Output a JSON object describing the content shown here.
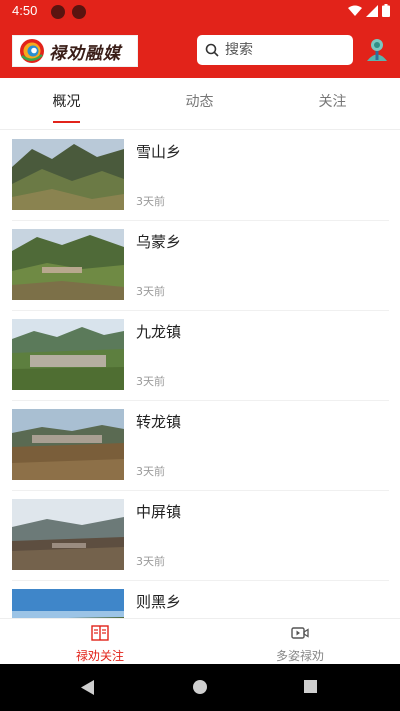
{
  "status_bar": {
    "time": "4:50"
  },
  "header": {
    "logo_text": "禄劝融媒",
    "search_placeholder": "搜索",
    "brand_color": "#e2231a"
  },
  "tabs": [
    {
      "label": "概况",
      "active": true
    },
    {
      "label": "动态",
      "active": false
    },
    {
      "label": "关注",
      "active": false
    }
  ],
  "list": [
    {
      "title": "雪山乡",
      "time": "3天前"
    },
    {
      "title": "乌蒙乡",
      "time": "3天前"
    },
    {
      "title": "九龙镇",
      "time": "3天前"
    },
    {
      "title": "转龙镇",
      "time": "3天前"
    },
    {
      "title": "中屏镇",
      "time": "3天前"
    },
    {
      "title": "则黑乡",
      "time": ""
    }
  ],
  "bottom_nav": [
    {
      "label": "禄劝关注",
      "icon": "book-icon",
      "active": true
    },
    {
      "label": "多姿禄劝",
      "icon": "video-icon",
      "active": false
    }
  ],
  "icons": {
    "status": [
      "wifi-icon",
      "signal-icon",
      "battery-icon"
    ],
    "system_nav": [
      "back-icon",
      "home-icon",
      "recents-icon"
    ]
  }
}
